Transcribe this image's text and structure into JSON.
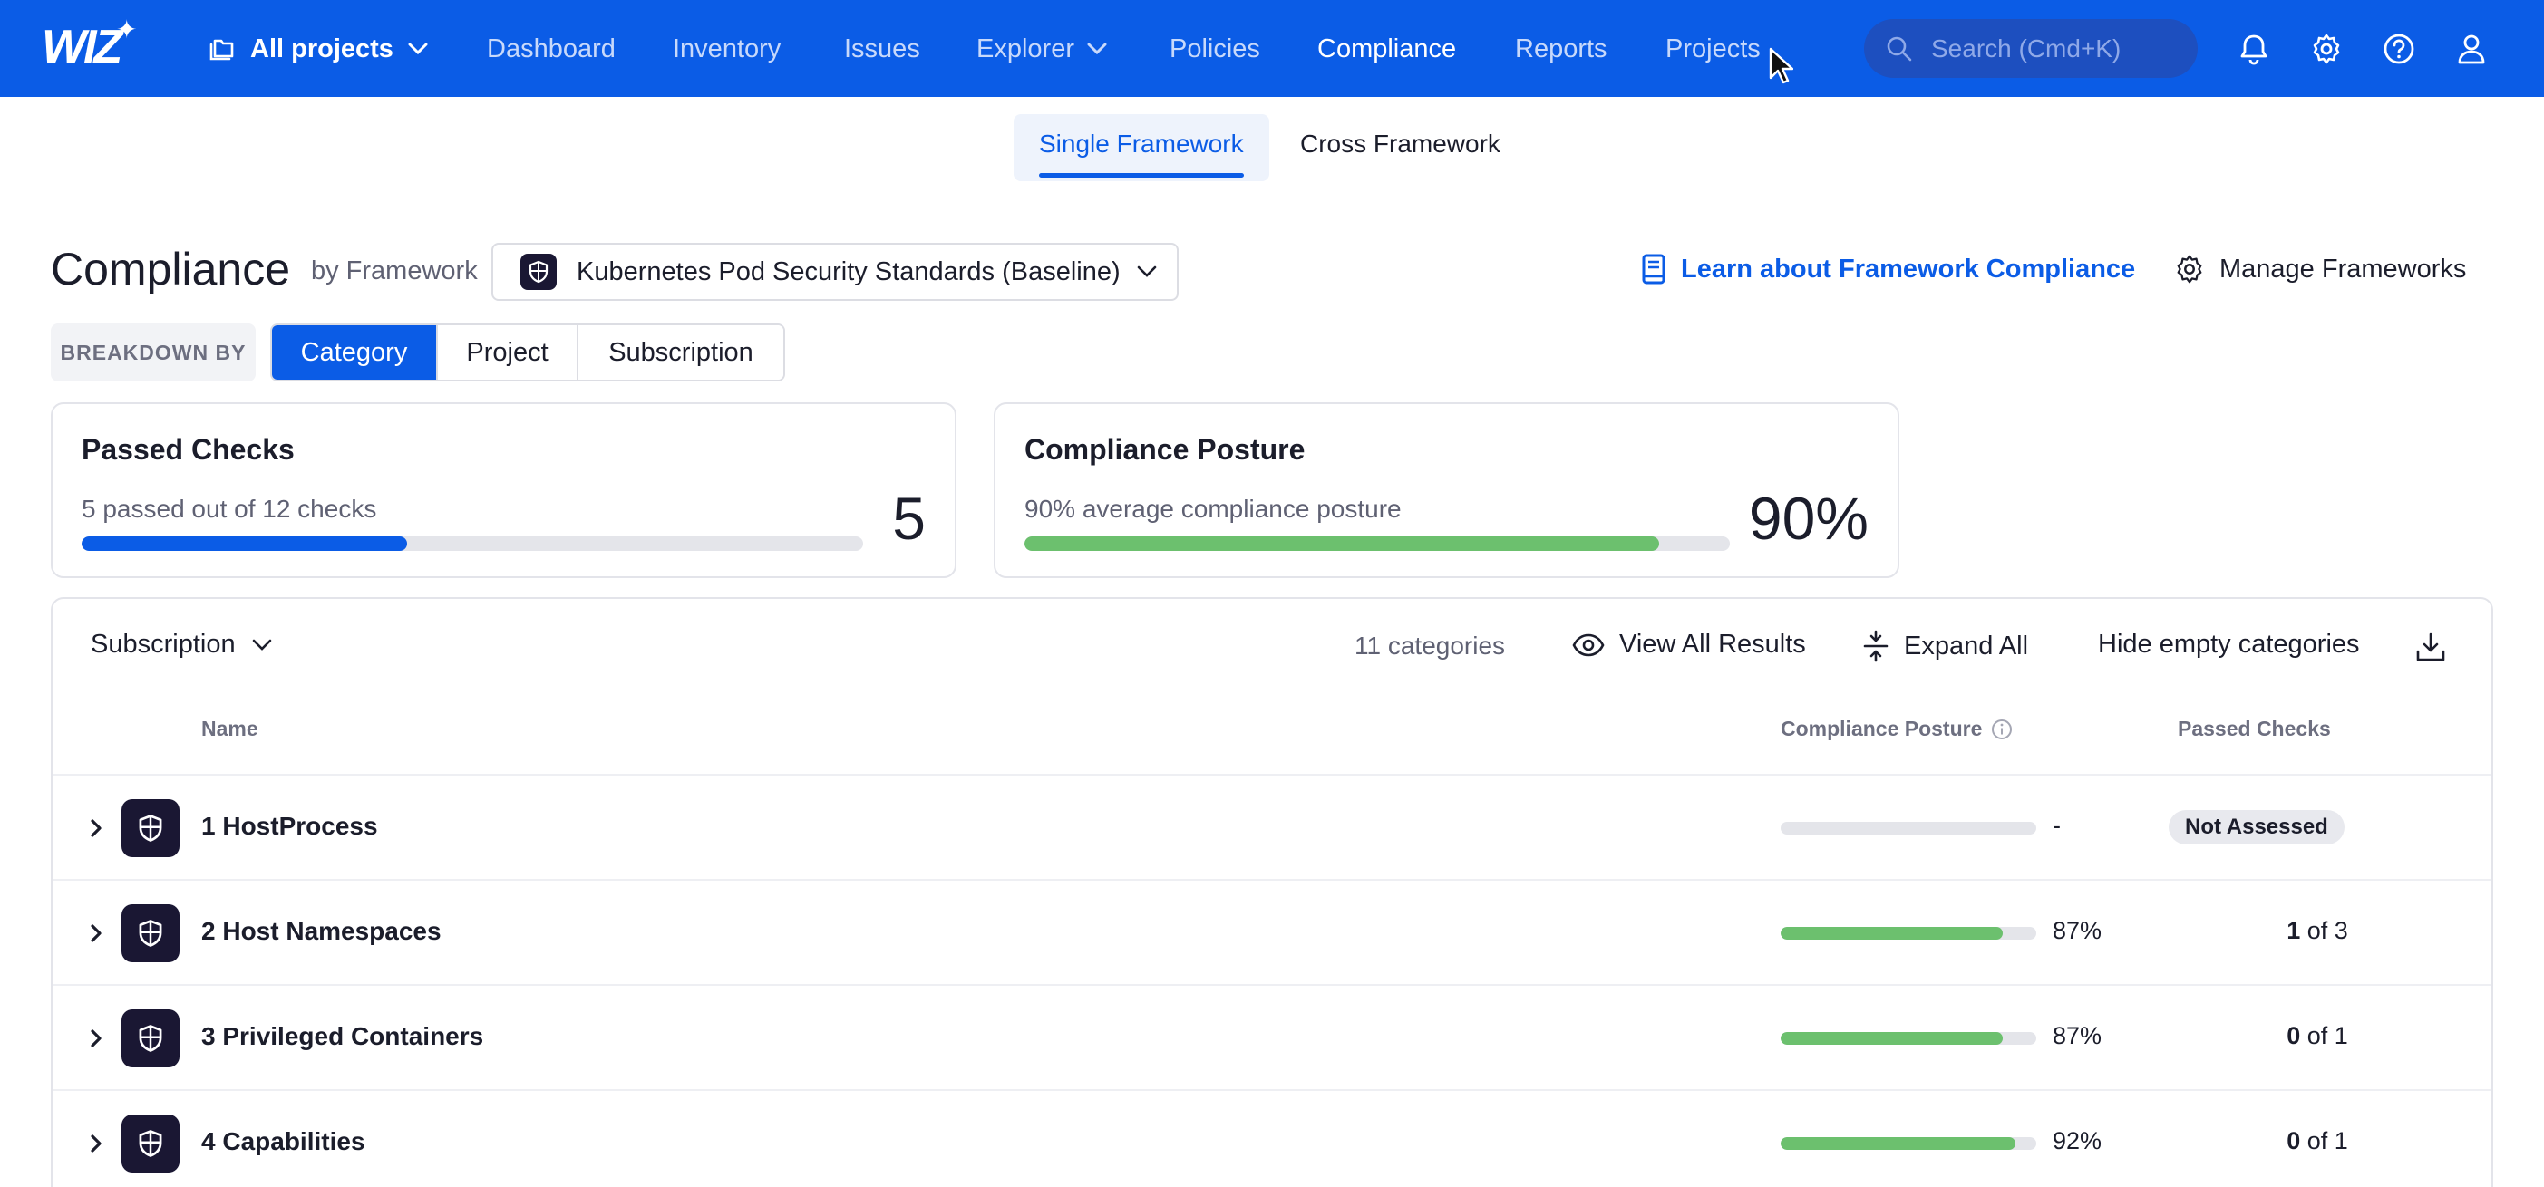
{
  "nav": {
    "logo": "WIZ",
    "project_selector": "All projects",
    "items": [
      "Dashboard",
      "Inventory",
      "Issues",
      "Explorer",
      "Policies",
      "Compliance",
      "Reports",
      "Projects"
    ],
    "active": "Compliance",
    "search_placeholder": "Search (Cmd+K)",
    "accent_color": "#0b5ce6"
  },
  "subtabs": [
    "Single Framework",
    "Cross Framework"
  ],
  "header": {
    "title": "Compliance",
    "by_label": "by Framework",
    "framework": "Kubernetes Pod Security Standards (Baseline)",
    "learn_link": "Learn about Framework Compliance",
    "manage_button": "Manage Frameworks"
  },
  "breakdown": {
    "label": "BREAKDOWN BY",
    "options": [
      "Category",
      "Project",
      "Subscription"
    ],
    "selected": "Category"
  },
  "cards": {
    "passed": {
      "title": "Passed Checks",
      "subtitle": "5 passed out of 12 checks",
      "value": "5",
      "progress": 0.417,
      "color": "#0b5ce6"
    },
    "posture": {
      "title": "Compliance Posture",
      "subtitle": "90% average compliance posture",
      "value": "90%",
      "progress": 0.9,
      "color": "#6cc06e"
    }
  },
  "table": {
    "group_by": "Subscription",
    "count_label": "11 categories",
    "view_all": "View All Results",
    "expand_all": "Expand All",
    "hide_empty": "Hide empty categories",
    "headers": {
      "name": "Name",
      "posture": "Compliance Posture",
      "passed": "Passed Checks"
    },
    "rows": [
      {
        "name": "1 HostProcess",
        "posture": null,
        "posture_label": "-",
        "passed": null,
        "total": null,
        "status": "Not Assessed"
      },
      {
        "name": "2 Host Namespaces",
        "posture": 0.87,
        "posture_label": "87%",
        "passed": "1",
        "of_total": " of 3"
      },
      {
        "name": "3 Privileged Containers",
        "posture": 0.87,
        "posture_label": "87%",
        "passed": "0",
        "of_total": " of 1"
      },
      {
        "name": "4 Capabilities",
        "posture": 0.92,
        "posture_label": "92%",
        "passed": "0",
        "of_total": " of 1"
      }
    ]
  }
}
